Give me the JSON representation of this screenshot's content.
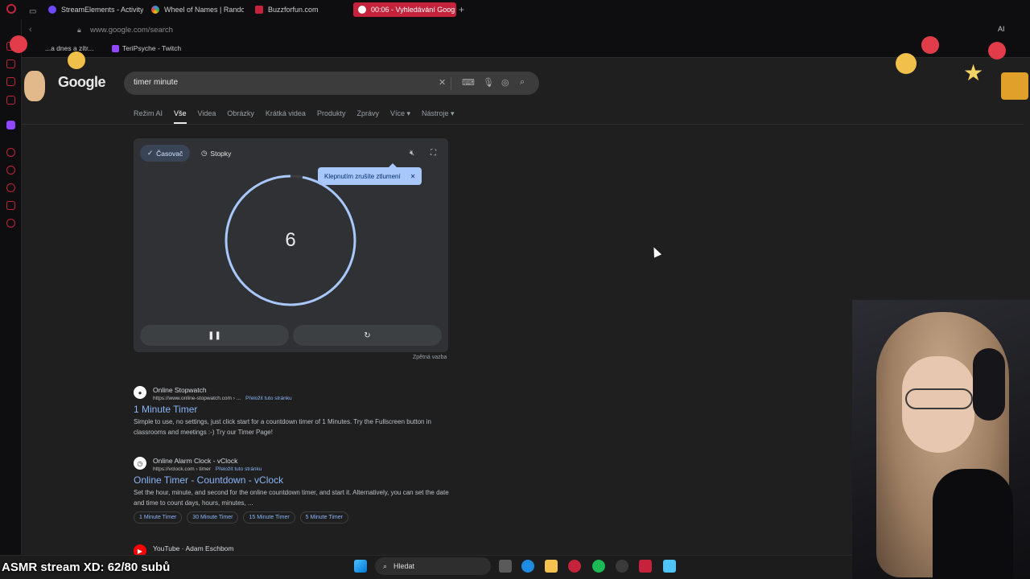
{
  "browser": {
    "tabs": [
      {
        "label": "StreamElements - Activity",
        "color": "#6d4aff"
      },
      {
        "label": "Wheel of Names | Random",
        "color": "#4285f4"
      },
      {
        "label": "Buzzforfun.com",
        "color": "#c5223c"
      },
      {
        "label": "00:06 - Vyhledávání Goog",
        "color": "#ffffff",
        "active": true
      }
    ],
    "new_tab": "+",
    "url": "www.google.com/search",
    "bookmarks": [
      {
        "label": "...a dnes a zítr..."
      },
      {
        "label": "TeriPsyche - Twitch"
      }
    ],
    "toolbar_ai": "AI"
  },
  "google": {
    "logo": "Google",
    "query": "timer minute",
    "tabs": [
      "Režim AI",
      "Vše",
      "Videa",
      "Obrázky",
      "Krátká videa",
      "Produkty",
      "Zprávy",
      "Více ▾",
      "Nástroje ▾"
    ],
    "active_tab": "Vše"
  },
  "timer": {
    "mode_active": "Časovač",
    "mode_other": "Stopky",
    "tooltip": "Klepnutím zrušíte ztlumení",
    "remaining_seconds": "6",
    "progress_fraction": 0.97,
    "pause_icon": "pause-icon",
    "reset_icon": "reset-icon",
    "feedback": "Zpětná vazba"
  },
  "results": [
    {
      "site": "Online Stopwatch",
      "url": "https://www.online-stopwatch.com › ...",
      "translate": "Přeložit tuto stránku",
      "title": "1 Minute Timer",
      "snippet": "Simple to use, no settings, just click start for a countdown timer of 1 Minutes. Try the Fullscreen button in classrooms and meetings :-) Try our Timer Page!"
    },
    {
      "site": "Online Alarm Clock - vClock",
      "url": "https://vclock.com › timer",
      "translate": "Přeložit tuto stránku",
      "title": "Online Timer - Countdown - vClock",
      "snippet": "Set the hour, minute, and second for the online countdown timer, and start it. Alternatively, you can set the date and time to count days, hours, minutes, ...",
      "chips": [
        "1 Minute Timer",
        "30 Minute Timer",
        "15 Minute Timer",
        "5 Minute Timer"
      ]
    },
    {
      "site": "YouTube · Adam Eschbom"
    }
  ],
  "taskbar": {
    "search_placeholder": "Hledat"
  },
  "stream_overlay": "ASMR stream XD: 62/80 subů",
  "colors": {
    "accent": "#c5223c",
    "link": "#8ab4f8",
    "ring": "#a8c7fa"
  }
}
